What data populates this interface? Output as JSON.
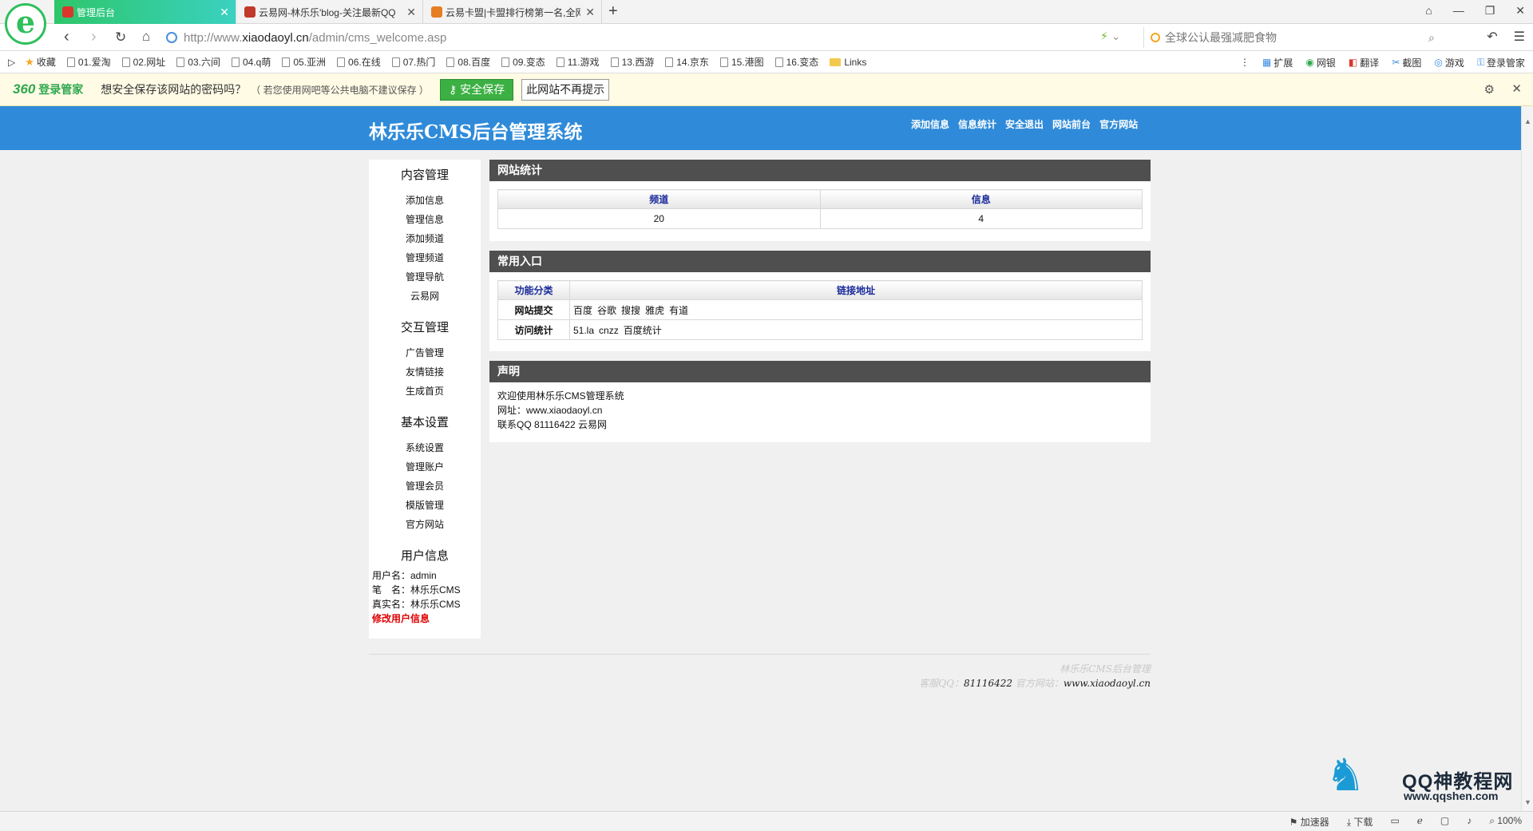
{
  "browser": {
    "logo_glyph": "e",
    "tabs": [
      {
        "title": "管理后台",
        "active": true,
        "icon_color": "#d9372b"
      },
      {
        "title": "云易网-林乐乐'blog-关注最新QQ",
        "active": false,
        "icon_color": "#c0392b"
      },
      {
        "title": "云易卡盟|卡盟排行榜第一名,全网",
        "active": false,
        "icon_color": "#e67e22"
      }
    ],
    "new_tab": "+",
    "url_prefix": "http://www.",
    "url_domain": "xiaodaoyl.cn",
    "url_path": "/admin/cms_welcome.asp",
    "search_placeholder": "全球公认最强减肥食物",
    "bookmarks_label": "收藏",
    "bookmarks": [
      "01.爱淘",
      "02.网址",
      "03.六间",
      "04.q萌",
      "05.亚洲",
      "06.在线",
      "07.热门",
      "08.百度",
      "09.变态",
      "11.游戏",
      "13.西游",
      "14.京东",
      "15.港图",
      "16.变态"
    ],
    "bookmark_folder": "Links",
    "extensions": [
      "扩展",
      "网银",
      "翻译",
      "截图",
      "游戏",
      "登录管家"
    ]
  },
  "password_bar": {
    "brand_num": "360",
    "brand_text": "登录管家",
    "message": "想安全保存该网站的密码吗？",
    "note": "（ 若您使用网吧等公共电脑不建议保存 ）",
    "save_label": "安全保存",
    "never_label": "此网站不再提示"
  },
  "site": {
    "title": "林乐乐CMS后台管理系统",
    "top_links": [
      "添加信息",
      "信息统计",
      "安全退出",
      "网站前台",
      "官方网站"
    ]
  },
  "sidebar": {
    "groups": [
      {
        "title": "内容管理",
        "items": [
          "添加信息",
          "管理信息",
          "添加频道",
          "管理频道",
          "管理导航",
          "云易网"
        ]
      },
      {
        "title": "交互管理",
        "items": [
          "广告管理",
          "友情链接",
          "生成首页"
        ]
      },
      {
        "title": "基本设置",
        "items": [
          "系统设置",
          "管理账户",
          "管理会员",
          "模版管理",
          "官方网站"
        ]
      }
    ],
    "user_title": "用户信息",
    "user_lines": [
      "用户名：admin",
      "笔　名：林乐乐CMS",
      "真实名：林乐乐CMS"
    ],
    "edit_label": "修改用户信息"
  },
  "stats": {
    "title": "网站统计",
    "headers": [
      "频道",
      "信息"
    ],
    "values": [
      "20",
      "4"
    ]
  },
  "entries": {
    "title": "常用入口",
    "headers": [
      "功能分类",
      "链接地址"
    ],
    "rows": [
      {
        "label": "网站提交",
        "links": [
          "百度",
          "谷歌",
          "搜搜",
          "雅虎",
          "有道"
        ]
      },
      {
        "label": "访问统计",
        "links": [
          "51.la",
          "cnzz",
          "百度统计"
        ]
      }
    ]
  },
  "notice": {
    "title": "声明",
    "lines": [
      "欢迎使用林乐乐CMS管理系统",
      "网址：www.xiaodaoyl.cn",
      "联系QQ 81116422 云易网"
    ]
  },
  "footer": {
    "line1": "林乐乐CMS后台管理",
    "qq_label": "客服QQ：",
    "qq": "81116422",
    "site_label": "官方网站：",
    "site": "www.xiaodaoyl.cn"
  },
  "watermark": {
    "title": "QQ神教程网",
    "url": "www.qqshen.com"
  },
  "status": {
    "items": [
      "加速器",
      "下载"
    ],
    "zoom": "100%"
  }
}
